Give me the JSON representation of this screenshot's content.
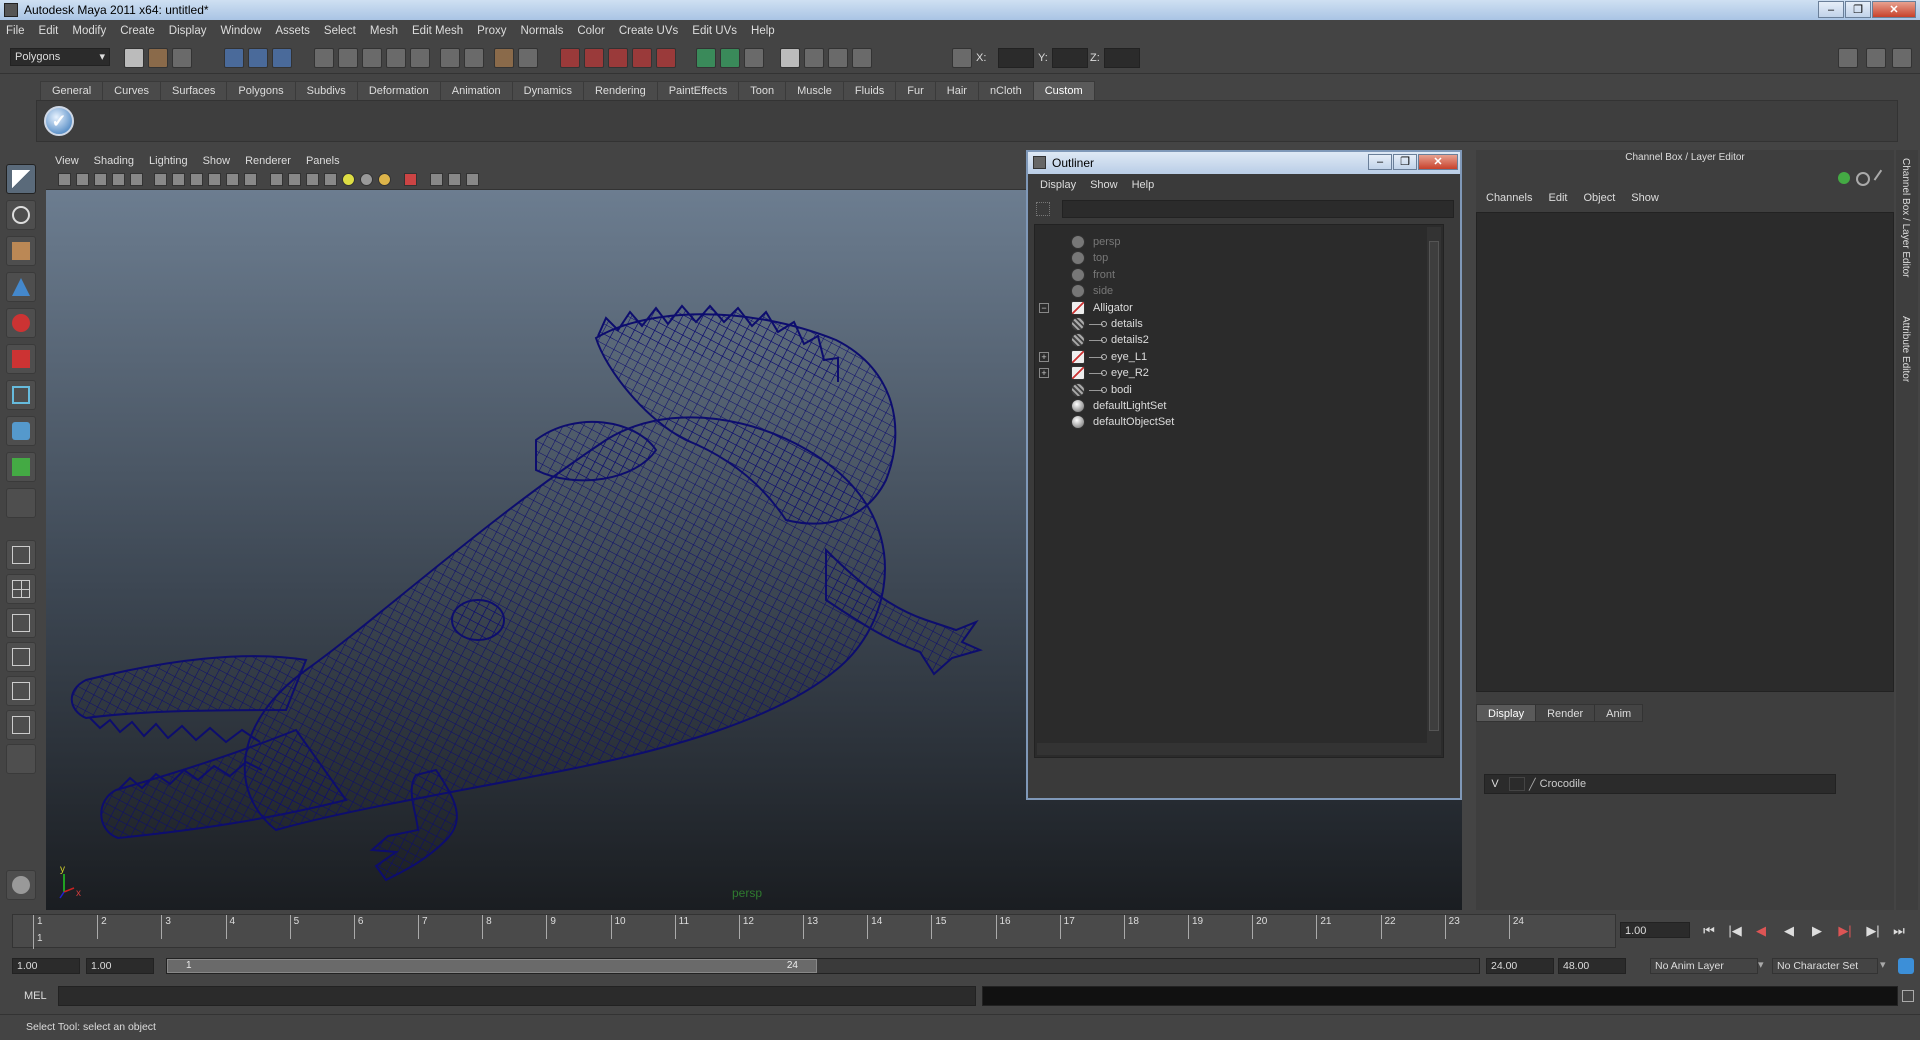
{
  "window": {
    "title": "Autodesk Maya 2011 x64: untitled*",
    "minimize": "–",
    "restore": "❐",
    "close": "✕"
  },
  "menubar": [
    "File",
    "Edit",
    "Modify",
    "Create",
    "Display",
    "Window",
    "Assets",
    "Select",
    "Mesh",
    "Edit Mesh",
    "Proxy",
    "Normals",
    "Color",
    "Create UVs",
    "Edit UVs",
    "Help"
  ],
  "statusline": {
    "menu_set": "Polygons",
    "x_label": "X:",
    "y_label": "Y:",
    "z_label": "Z:"
  },
  "shelf": {
    "tabs": [
      "General",
      "Curves",
      "Surfaces",
      "Polygons",
      "Subdivs",
      "Deformation",
      "Animation",
      "Dynamics",
      "Rendering",
      "PaintEffects",
      "Toon",
      "Muscle",
      "Fluids",
      "Fur",
      "Hair",
      "nCloth",
      "Custom"
    ],
    "active": "Custom",
    "custom_icon_glyph": "✓"
  },
  "viewport": {
    "menu": [
      "View",
      "Shading",
      "Lighting",
      "Show",
      "Renderer",
      "Panels"
    ],
    "camera": "persp",
    "axis_y": "y",
    "axis_x": "x",
    "mesh_color": "#0d0d6e"
  },
  "outliner": {
    "title": "Outliner",
    "minimize": "–",
    "maximize": "❐",
    "close": "✕",
    "menu": [
      "Display",
      "Show",
      "Help"
    ],
    "items": [
      {
        "label": "persp",
        "icon": "camera-icon",
        "dim": true
      },
      {
        "label": "top",
        "icon": "camera-icon",
        "dim": true
      },
      {
        "label": "front",
        "icon": "camera-icon",
        "dim": true
      },
      {
        "label": "side",
        "icon": "camera-icon",
        "dim": true
      },
      {
        "label": "Alligator",
        "icon": "transform-icon",
        "expanded": true
      },
      {
        "label": "details",
        "icon": "mesh-icon"
      },
      {
        "label": "details2",
        "icon": "mesh-icon"
      },
      {
        "label": "eye_L1",
        "icon": "transform-icon",
        "collapsed": true
      },
      {
        "label": "eye_R2",
        "icon": "transform-icon",
        "collapsed": true
      },
      {
        "label": "bodi",
        "icon": "mesh-icon"
      },
      {
        "label": "defaultLightSet",
        "icon": "set-icon"
      },
      {
        "label": "defaultObjectSet",
        "icon": "set-icon"
      }
    ],
    "expand_minus": "−",
    "expand_plus": "+"
  },
  "channel_box": {
    "title": "Channel Box / Layer Editor",
    "menu": [
      "Channels",
      "Edit",
      "Object",
      "Show"
    ],
    "layer_tabs": [
      "Display",
      "Render",
      "Anim"
    ],
    "active_layer_tab": "Display",
    "layer": {
      "visible": "V",
      "name": "Crocodile"
    }
  },
  "side_tabs": {
    "channel": "Channel Box / Layer Editor",
    "attribute": "Attribute Editor"
  },
  "timeline": {
    "start": 1,
    "end": 24,
    "current_frame": "1.00",
    "frame_marker": "1"
  },
  "range": {
    "anim_start": "1.00",
    "play_start": "1.00",
    "range_start": "1",
    "range_end": "24",
    "play_end": "24.00",
    "anim_end": "48.00",
    "anim_layer": "No Anim Layer",
    "char_set": "No Character Set"
  },
  "command": {
    "label": "MEL"
  },
  "help_line": "Select Tool: select an object"
}
